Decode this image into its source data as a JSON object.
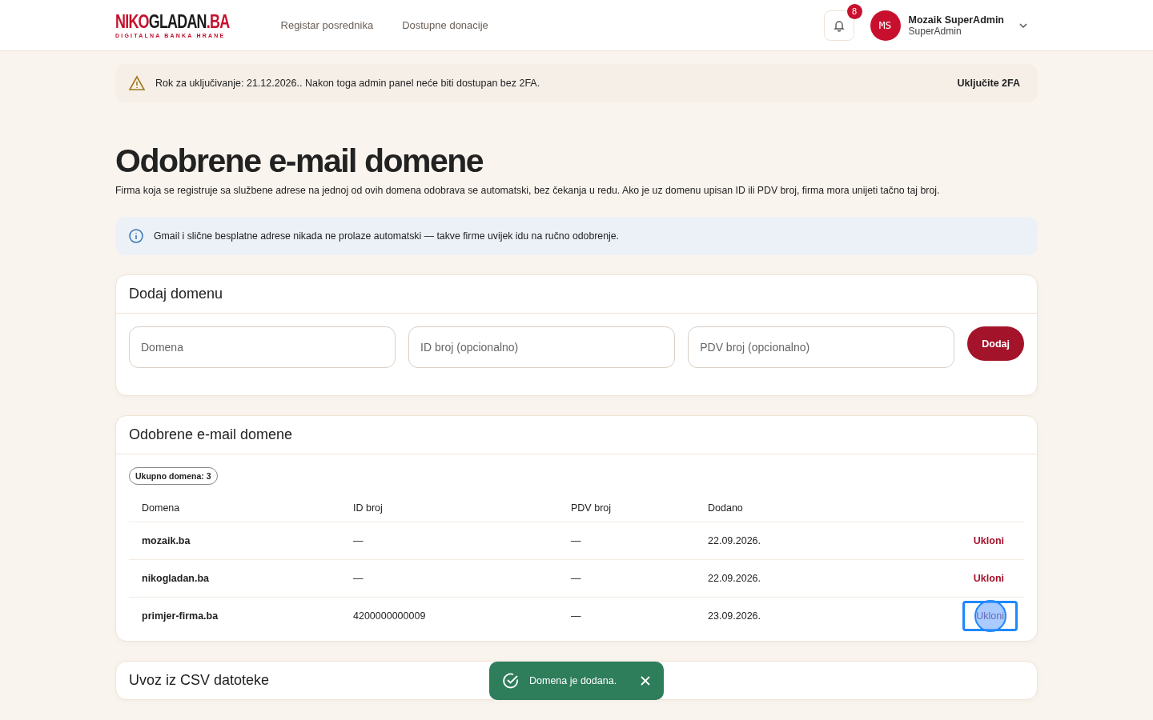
{
  "header": {
    "logo": {
      "parts": [
        {
          "text": "NIKO",
          "color": "#c8102e"
        },
        {
          "text": "GLADAN",
          "color": "#1a1a1a"
        },
        {
          "text": ".BA",
          "color": "#c8102e"
        }
      ],
      "tagline": "DIGITALNA BANKA HRANE"
    },
    "nav": [
      "Registar posrednika",
      "Dostupne donacije"
    ],
    "notifications": {
      "count": "8"
    },
    "user": {
      "initials": "MS",
      "name": "Mozaik SuperAdmin",
      "role": "SuperAdmin"
    }
  },
  "warning": {
    "text": "Rok za uključivanje: 21.12.2026.. Nakon toga admin panel neće biti dostupan bez 2FA.",
    "action": "Uključite 2FA"
  },
  "page": {
    "title": "Odobrene e-mail domene",
    "description": "Firma koja se registruje sa službene adrese na jednoj od ovih domena odobrava se automatski, bez čekanja u redu. Ako je uz domenu upisan ID ili PDV broj, firma mora unijeti tačno taj broj."
  },
  "info": {
    "text": "Gmail i slične besplatne adrese nikada ne prolaze automatski — takve firme uvijek idu na ručno odobrenje."
  },
  "add_form": {
    "title": "Dodaj domenu",
    "fields": [
      {
        "placeholder": "Domena"
      },
      {
        "placeholder": "ID broj (opcionalno)"
      },
      {
        "placeholder": "PDV broj (opcionalno)"
      }
    ],
    "button": "Dodaj"
  },
  "domains": {
    "title": "Odobrene e-mail domene",
    "count_badge": "Ukupno domena: 3",
    "columns": [
      "Domena",
      "ID broj",
      "PDV broj",
      "Dodano"
    ],
    "rows": [
      {
        "domain": "mozaik.ba",
        "id": "—",
        "pdv": "—",
        "added": "22.09.2026.",
        "action": "Ukloni",
        "focused": false
      },
      {
        "domain": "nikogladan.ba",
        "id": "—",
        "pdv": "—",
        "added": "22.09.2026.",
        "action": "Ukloni",
        "focused": false
      },
      {
        "domain": "primjer-firma.ba",
        "id": "4200000000009",
        "pdv": "—",
        "added": "23.09.2026.",
        "action": "Ukloni",
        "focused": true
      }
    ]
  },
  "csv": {
    "title": "Uvoz iz CSV datoteke"
  },
  "toast": {
    "text": "Domena je dodana."
  }
}
